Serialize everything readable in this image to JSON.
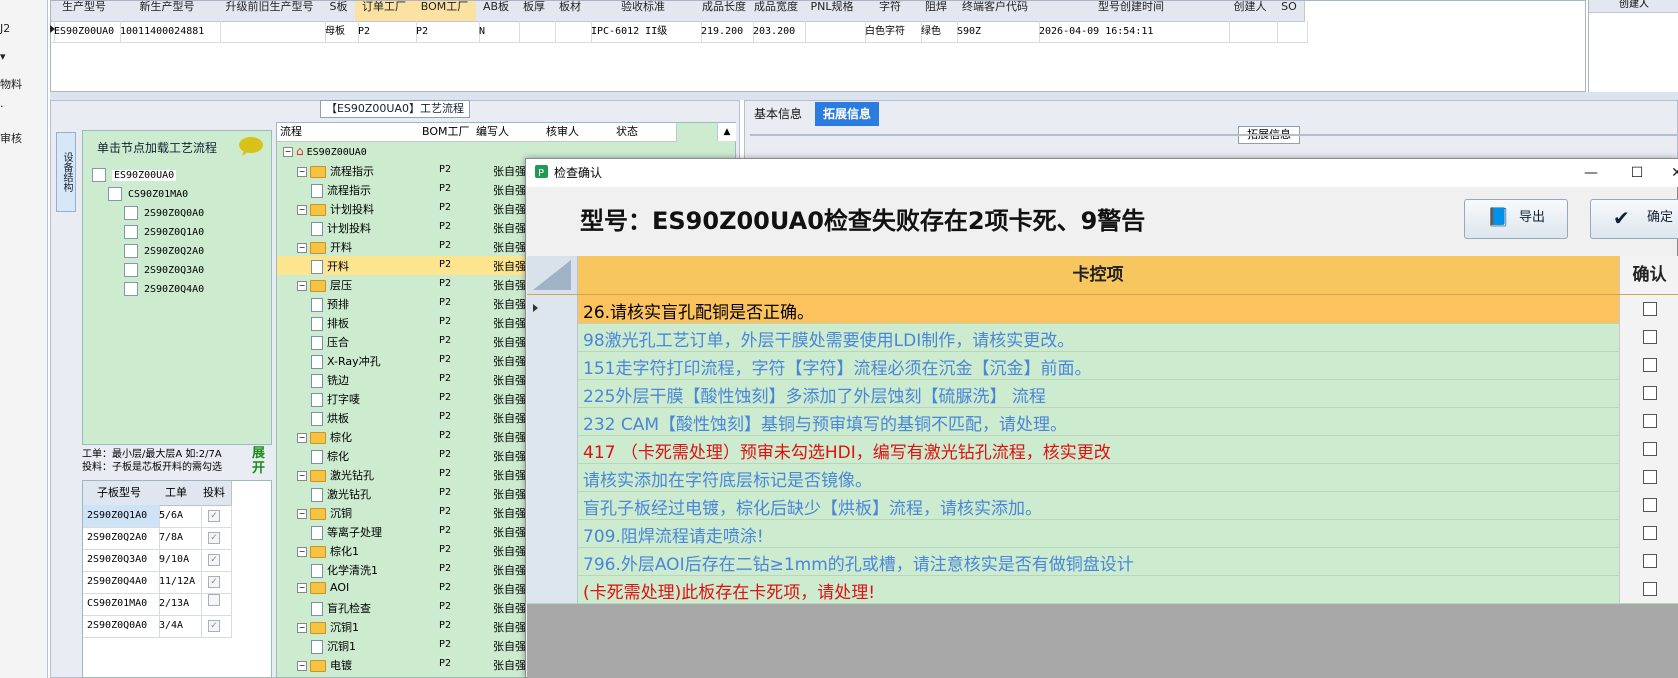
{
  "left_strip": {
    "items": [
      "J2",
      "物料",
      "审核"
    ]
  },
  "top_grid": {
    "headers": [
      "生产型号",
      "新生产型号",
      "升级前旧生产型号",
      "S板",
      "订单工厂",
      "BOM工厂",
      "AB板",
      "板厚",
      "板材",
      "验收标准",
      "成品长度",
      "成品宽度",
      "PNL规格",
      "字符",
      "阻焊",
      "终端客户代码",
      "型号创建时间",
      "创建人",
      "SO"
    ],
    "row": [
      "ES90Z00UA0",
      "10011400024881",
      "",
      "母板",
      "P2",
      "P2",
      "N",
      "",
      "",
      "IPC-6012 II级",
      "219.200",
      "203.200",
      "",
      "白色字符",
      "绿色",
      "S90Z",
      "2026-04-09 16:54:11",
      "",
      ""
    ],
    "right_label": "创建人"
  },
  "process_panel": {
    "title": "【ES90Z00UA0】工艺流程",
    "vtab_label": "设备结构",
    "tree_header": "单击节点加载工艺流程",
    "tree": [
      {
        "label": "ES90Z00UA0",
        "level": 0
      },
      {
        "label": "CS90Z01MA0",
        "level": 1
      },
      {
        "label": "2S90Z0Q0A0",
        "level": 2
      },
      {
        "label": "2S90Z0Q1A0",
        "level": 2
      },
      {
        "label": "2S90Z0Q2A0",
        "level": 2
      },
      {
        "label": "2S90Z0Q3A0",
        "level": 2
      },
      {
        "label": "2S90Z0Q4A0",
        "level": 2
      }
    ],
    "info_line1": "工单：最小层/最大层A 如:2/7A",
    "info_line2": "投料：子板是芯板开料的需勾选",
    "expand_label": "展开",
    "sub_headers": [
      "子板型号",
      "工单",
      "投料"
    ],
    "sub_rows": [
      {
        "model": "2S90Z0Q1A0",
        "wo": "5/6A",
        "checked": true
      },
      {
        "model": "2S90Z0Q2A0",
        "wo": "7/8A",
        "checked": true
      },
      {
        "model": "2S90Z0Q3A0",
        "wo": "9/10A",
        "checked": true
      },
      {
        "model": "2S90Z0Q4A0",
        "wo": "11/12A",
        "checked": true
      },
      {
        "model": "CS90Z01MA0",
        "wo": "2/13A",
        "checked": false
      },
      {
        "model": "2S90Z0Q0A0",
        "wo": "3/4A",
        "checked": true
      }
    ],
    "grid_headers": [
      "流程",
      "BOM工厂",
      "编写人",
      "核审人",
      "状态"
    ],
    "grid_rows": [
      {
        "name": "ES90Z00UA0",
        "type": "root",
        "level": 0,
        "bom": "",
        "writer": ""
      },
      {
        "name": "流程指示",
        "type": "folder",
        "level": 1,
        "bom": "P2",
        "writer": "张自强"
      },
      {
        "name": "流程指示",
        "type": "doc",
        "level": 2,
        "bom": "P2",
        "writer": "张自强"
      },
      {
        "name": "计划投料",
        "type": "folder",
        "level": 1,
        "bom": "P2",
        "writer": "张自强"
      },
      {
        "name": "计划投料",
        "type": "doc",
        "level": 2,
        "bom": "P2",
        "writer": "张自强"
      },
      {
        "name": "开料",
        "type": "folder",
        "level": 1,
        "bom": "P2",
        "writer": "张自强"
      },
      {
        "name": "开料",
        "type": "doc",
        "level": 2,
        "bom": "P2",
        "writer": "张自强",
        "selected": true
      },
      {
        "name": "层压",
        "type": "folder",
        "level": 1,
        "bom": "P2",
        "writer": "张自强"
      },
      {
        "name": "预排",
        "type": "doc",
        "level": 2,
        "bom": "P2",
        "writer": "张自强"
      },
      {
        "name": "排板",
        "type": "doc",
        "level": 2,
        "bom": "P2",
        "writer": "张自强"
      },
      {
        "name": "压合",
        "type": "doc",
        "level": 2,
        "bom": "P2",
        "writer": "张自强"
      },
      {
        "name": "X-Ray冲孔",
        "type": "doc",
        "level": 2,
        "bom": "P2",
        "writer": "张自强"
      },
      {
        "name": "铣边",
        "type": "doc",
        "level": 2,
        "bom": "P2",
        "writer": "张自强"
      },
      {
        "name": "打字唛",
        "type": "doc",
        "level": 2,
        "bom": "P2",
        "writer": "张自强"
      },
      {
        "name": "烘板",
        "type": "doc",
        "level": 2,
        "bom": "P2",
        "writer": "张自强"
      },
      {
        "name": "棕化",
        "type": "folder",
        "level": 1,
        "bom": "P2",
        "writer": "张自强"
      },
      {
        "name": "棕化",
        "type": "doc",
        "level": 2,
        "bom": "P2",
        "writer": "张自强"
      },
      {
        "name": "激光钻孔",
        "type": "folder",
        "level": 1,
        "bom": "P2",
        "writer": "张自强"
      },
      {
        "name": "激光钻孔",
        "type": "doc",
        "level": 2,
        "bom": "P2",
        "writer": "张自强"
      },
      {
        "name": "沉铜",
        "type": "folder",
        "level": 1,
        "bom": "P2",
        "writer": "张自强"
      },
      {
        "name": "等离子处理",
        "type": "doc",
        "level": 2,
        "bom": "P2",
        "writer": "张自强"
      },
      {
        "name": "棕化1",
        "type": "folder",
        "level": 1,
        "bom": "P2",
        "writer": "张自强"
      },
      {
        "name": "化学清洗1",
        "type": "doc",
        "level": 2,
        "bom": "P2",
        "writer": "张自强"
      },
      {
        "name": "AOI",
        "type": "folder",
        "level": 1,
        "bom": "P2",
        "writer": "张自强"
      },
      {
        "name": "盲孔检查",
        "type": "doc",
        "level": 2,
        "bom": "P2",
        "writer": "张自强"
      },
      {
        "name": "沉铜1",
        "type": "folder",
        "level": 1,
        "bom": "P2",
        "writer": "张自强"
      },
      {
        "name": "沉铜1",
        "type": "doc",
        "level": 2,
        "bom": "P2",
        "writer": "张自强"
      },
      {
        "name": "电镀",
        "type": "folder",
        "level": 1,
        "bom": "P2",
        "writer": "张自强"
      }
    ]
  },
  "right_tabs": {
    "basic": "基本信息",
    "extended": "拓展信息",
    "group_label": "拓展信息"
  },
  "dialog": {
    "title": "检查确认",
    "message": "型号：ES90Z00UA0检查失败存在2项卡死、9警告",
    "export_label": "导出",
    "confirm_label": "确定",
    "col_item": "卡控项",
    "col_confirm": "确认",
    "rows": [
      {
        "text": "26.请核实盲孔配铜是否正确。",
        "color": "#000000",
        "selected": true
      },
      {
        "text": "98激光孔工艺订单，外层干膜处需要使用LDI制作，请核实更改。",
        "color": "#4a86d9"
      },
      {
        "text": "151走字符打印流程，字符【字符】流程必须在沉金【沉金】前面。",
        "color": "#4a86d9"
      },
      {
        "text": "225外层干膜【酸性蚀刻】多添加了外层蚀刻【硫脲洗】 流程",
        "color": "#4a86d9"
      },
      {
        "text": "232 CAM【酸性蚀刻】基铜与预审填写的基铜不匹配，请处理。",
        "color": "#4a86d9"
      },
      {
        "text": "417 （卡死需处理）预审未勾选HDI，编写有激光钻孔流程，核实更改",
        "color": "#e01010"
      },
      {
        "text": "请核实添加在字符底层标记是否镜像。",
        "color": "#4a86d9"
      },
      {
        "text": "盲孔子板经过电镀，棕化后缺少【烘板】流程，请核实添加。",
        "color": "#4a86d9"
      },
      {
        "text": "709.阻焊流程请走喷涂!",
        "color": "#4a86d9"
      },
      {
        "text": "796.外层AOI后存在二钻≥1mm的孔或槽，请注意核实是否有做铜盘设计",
        "color": "#4a86d9"
      },
      {
        "text": "(卡死需处理)此板存在卡死项，请处理!",
        "color": "#e01010"
      }
    ]
  }
}
